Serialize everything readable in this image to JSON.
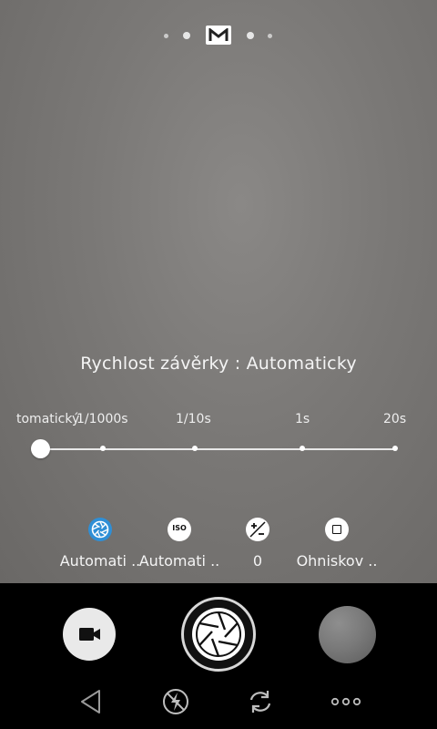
{
  "mode_indicator": {
    "active_mode": "M",
    "mode_icon": "manual-mode-icon"
  },
  "setting": {
    "title": "Rychlost závěrky : Automaticky"
  },
  "slider": {
    "ticks": [
      "tomatický",
      "1/1000s",
      "1/10s",
      "1s",
      "20s"
    ],
    "selected_index": 0
  },
  "params": [
    {
      "icon": "aperture-blue-icon",
      "label": "Automati .."
    },
    {
      "icon": "iso-icon",
      "label": "Automati .."
    },
    {
      "icon": "exposure-compensation-icon",
      "label": "0"
    },
    {
      "icon": "focus-square-icon",
      "label": "Ohniskov .."
    }
  ],
  "controls": {
    "video": "video-camera-icon",
    "shutter": "shutter-aperture-icon",
    "gallery": "gallery-thumbnail"
  },
  "nav": [
    "back-triangle-icon",
    "flash-off-icon",
    "switch-camera-icon",
    "more-dots-icon"
  ],
  "colors": {
    "accent": "#2f8fd6",
    "viewfinder": "#7a7876",
    "bar": "#000000"
  }
}
